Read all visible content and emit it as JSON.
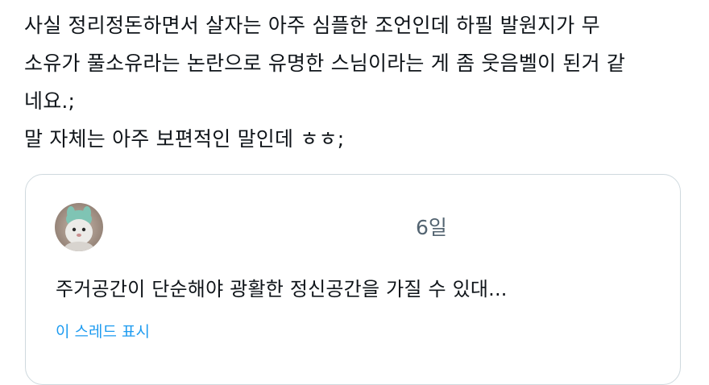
{
  "post": {
    "lines": [
      "사실 정리정돈하면서 살자는 아주 심플한 조언인데 하필 발원지가 무",
      "소유가 풀소유라는 논란으로 유명한 스님이라는 게 좀 웃음벨이 된거 같",
      "네요.;",
      "말 자체는 아주 보편적인 말인데 ㅎㅎ;"
    ]
  },
  "quote": {
    "avatar_icon": "plush-toy-avatar",
    "time": "6일",
    "text": "주거공간이 단순해야 광활한 정신공간을 가질 수 있대...",
    "show_thread": "이 스레드 표시"
  },
  "colors": {
    "text": "#0f1419",
    "secondary": "#536471",
    "link": "#1d9bf0",
    "border": "#cfd9de"
  }
}
